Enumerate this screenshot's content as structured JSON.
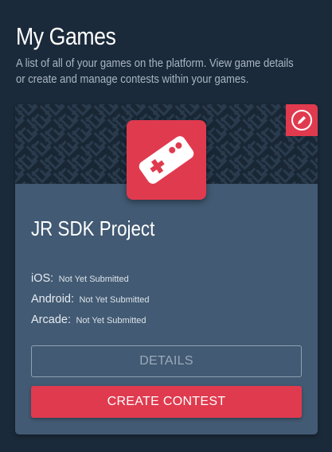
{
  "header": {
    "title": "My Games",
    "subtitle": "A list of all of your games on the platform. View game details or create and manage contests within your games."
  },
  "game_card": {
    "name": "JR SDK Project",
    "icon": "gamepad-icon",
    "edit_icon": "pencil-icon",
    "platforms": [
      {
        "name": "iOS",
        "status": "Not Yet Submitted"
      },
      {
        "name": "Android",
        "status": "Not Yet Submitted"
      },
      {
        "name": "Arcade",
        "status": "Not Yet Submitted"
      }
    ],
    "details_label": "DETAILS",
    "create_contest_label": "CREATE CONTEST"
  },
  "colors": {
    "background": "#1b2a3a",
    "card": "#425a73",
    "banner": "#192735",
    "accent": "#e03a4e"
  }
}
